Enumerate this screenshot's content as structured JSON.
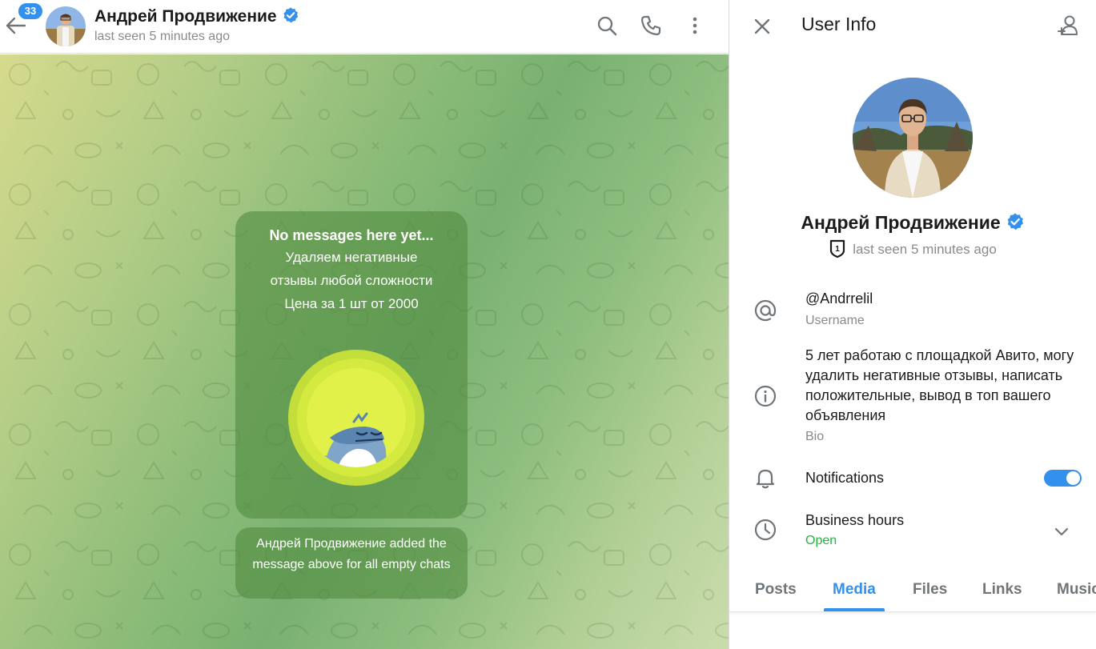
{
  "colors": {
    "accent": "#3390ec",
    "open_status": "#24b343",
    "bubble": "#528c40"
  },
  "chat_header": {
    "unread_count": "33",
    "peer_name": "Андрей Продвижение",
    "peer_status": "last seen 5 minutes ago",
    "icons": [
      "back-arrow-icon",
      "search-icon",
      "phone-icon",
      "more-vertical-icon",
      "verified-icon"
    ]
  },
  "chat": {
    "empty_title": "No messages here yet...",
    "empty_lines": [
      "Удаляем негативные",
      "отзывы любой сложности",
      "Цена за 1 шт от 2000"
    ],
    "service_message": "Андрей Продвижение added the message above for all empty chats"
  },
  "user_info": {
    "title": "User Info",
    "name": "Андрей Продвижение",
    "level": "1",
    "status": "last seen 5 minutes ago",
    "username": "@Andrrelil",
    "username_label": "Username",
    "bio": "5 лет работаю с площадкой Авито, могу удалить негативные отзывы, написать положительные, вывод в топ вашего объявления",
    "bio_label": "Bio",
    "notifications_label": "Notifications",
    "notifications_on": true,
    "business_hours_label": "Business hours",
    "business_hours_status": "Open",
    "icons": [
      "close-icon",
      "add-contact-icon",
      "at-icon",
      "info-icon",
      "bell-icon",
      "clock-icon",
      "chevron-down-icon"
    ]
  },
  "tabs": {
    "items": [
      "Posts",
      "Media",
      "Files",
      "Links",
      "Music"
    ],
    "active": "Media"
  }
}
